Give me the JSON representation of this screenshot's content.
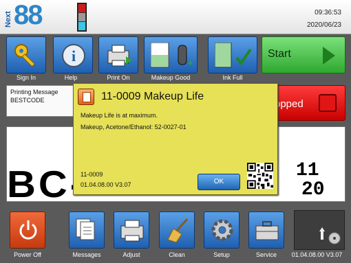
{
  "header": {
    "logo_prefix": "Next",
    "logo_number": "88",
    "time": "09:36:53",
    "date": "2020/06/23"
  },
  "toolbar": {
    "sign_in": "Sign In",
    "help": "Help",
    "print_on": "Print On",
    "makeup_good": "Makeup Good",
    "ink_full": "Ink Full",
    "start": "Start"
  },
  "message": {
    "title": "Printing Message",
    "name": "BESTCODE"
  },
  "status": {
    "label": "opped",
    "color": "#e02020"
  },
  "preview": {
    "left_text": "BC-",
    "right_top": "11",
    "right_bottom": "20"
  },
  "dialog": {
    "title": "11-0009 Makeup Life",
    "line1": "Makeup Life is at maximum.",
    "line2": "Makeup, Acetone/Ethanol: 52-0027-01",
    "code": "11-0009",
    "version": "01.04.08.00 V3.07",
    "ok_label": "OK",
    "background": "#e6e157"
  },
  "bottom": {
    "power_off": "Power Off",
    "messages": "Messages",
    "adjust": "Adjust",
    "clean": "Clean",
    "setup": "Setup",
    "service": "Service",
    "version": "01.04.08.00 V3.07"
  },
  "colors": {
    "button_blue": "#2f78c8",
    "start_green": "#3cb83c",
    "power_orange": "#d9481a"
  }
}
